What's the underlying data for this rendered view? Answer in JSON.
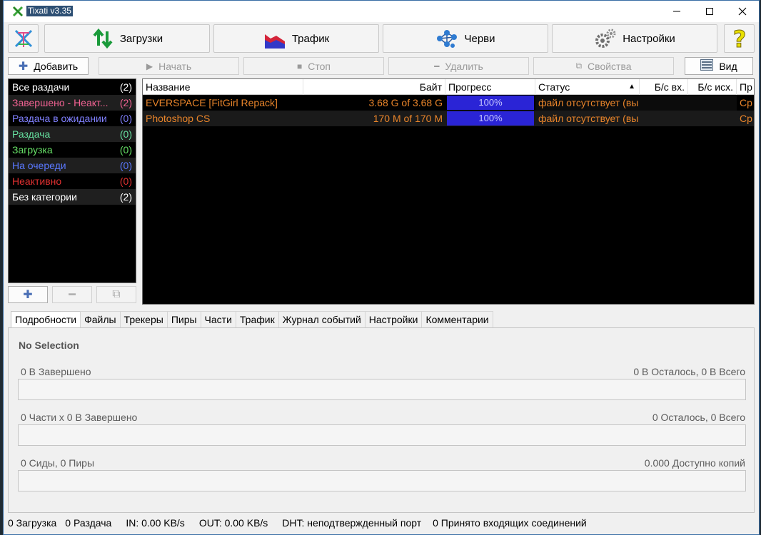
{
  "window": {
    "title": "Tixati v3.35"
  },
  "toolbar": {
    "downloads": "Загрузки",
    "traffic": "Трафик",
    "worms": "Черви",
    "settings": "Настройки",
    "help_icon": "help-icon"
  },
  "secondary": {
    "add": "Добавить",
    "start": "Начать",
    "stop": "Стоп",
    "delete": "Удалить",
    "properties": "Свойства",
    "view": "Вид"
  },
  "categories": [
    {
      "label": "Все раздачи",
      "count": "(2)",
      "color": "#ffffff"
    },
    {
      "label": "Завершено - Неакт...",
      "count": "(2)",
      "color": "#f06292"
    },
    {
      "label": "Раздача в ожидании",
      "count": "(0)",
      "color": "#8080ff"
    },
    {
      "label": "Раздача",
      "count": "(0)",
      "color": "#66e0a0"
    },
    {
      "label": "Загрузка",
      "count": "(0)",
      "color": "#66e066"
    },
    {
      "label": "На очереди",
      "count": "(0)",
      "color": "#5a78ff"
    },
    {
      "label": "Неактивно",
      "count": "(0)",
      "color": "#e03030"
    },
    {
      "label": "Без категории",
      "count": "(2)",
      "color": "#ffffff"
    }
  ],
  "table": {
    "headers": {
      "name": "Название",
      "bytes": "Байт",
      "progress": "Прогресс",
      "status": "Статус",
      "in": "Б/с вх.",
      "out": "Б/с исх.",
      "pr": "Пр"
    },
    "rows": [
      {
        "name": "EVERSPACE [FitGirl Repack]",
        "bytes": "3.68 G of 3.68 G",
        "progress": "100%",
        "progress_value": 1.0,
        "status": "файл отсутствует (вы",
        "pr": "Ср"
      },
      {
        "name": "Photoshop CS",
        "bytes": "170 M of 170 M",
        "progress": "100%",
        "progress_value": 1.0,
        "status": "файл отсутствует (вы",
        "pr": "Ср"
      }
    ]
  },
  "tabs": [
    "Подробности",
    "Файлы",
    "Трекеры",
    "Пиры",
    "Части",
    "Трафик",
    "Журнал событий",
    "Настройки",
    "Комментарии"
  ],
  "details": {
    "selection": "No Selection",
    "completed_label": "0 В Завершено",
    "remaining_label": "0 В Осталось,  0 В Всего",
    "parts_label": "0 Части  x  0 В Завершено",
    "parts_remaining": "0 Осталось,  0 Всего",
    "seeds_label": "0 Сиды, 0 Пиры",
    "copies_label": "0.000 Доступно копий"
  },
  "statusbar": {
    "downloads": "0 Загрузка",
    "seeding": "0 Раздача",
    "in": "IN: 0.00 KB/s",
    "out": "OUT: 0.00 KB/s",
    "dht": "DHT: неподтвержденный порт",
    "incoming": "0 Принято входящих соединений"
  },
  "colors": {
    "accent_orange": "#e8842a",
    "progress_blue": "#2a24d6"
  }
}
